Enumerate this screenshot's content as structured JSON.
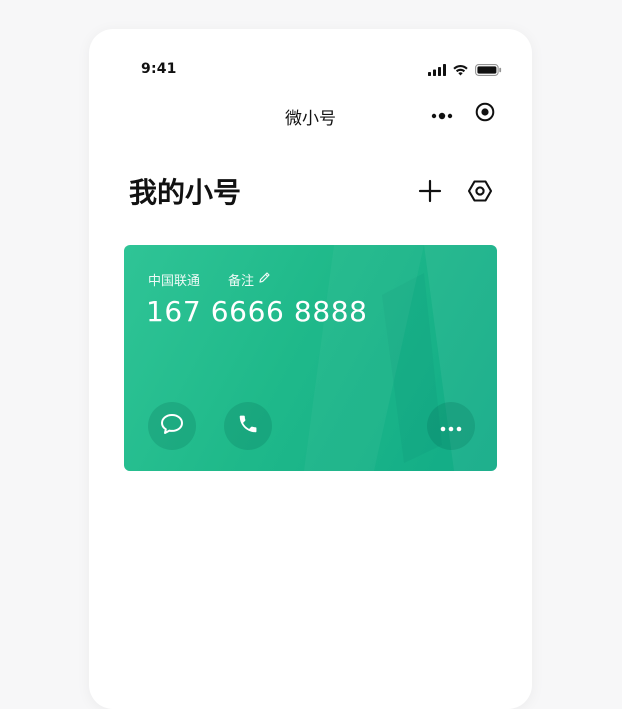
{
  "status_bar": {
    "time": "9:41"
  },
  "nav": {
    "title": "微小号"
  },
  "page": {
    "title": "我的小号"
  },
  "card": {
    "carrier": "中国联通",
    "note_label": "备注",
    "phone_number": "167 6666 8888"
  },
  "icons": {
    "signal": "signal-bars-icon",
    "wifi": "wifi-icon",
    "battery": "battery-icon",
    "capsule_more": "more-dots-icon",
    "capsule_close": "target-circle-icon",
    "add": "plus-icon",
    "settings": "hexagon-settings-icon",
    "edit": "pencil-icon",
    "message": "chat-bubble-icon",
    "call": "phone-handset-icon",
    "more": "ellipsis-icon"
  },
  "colors": {
    "card_gradient_start": "#2fc496",
    "card_gradient_end": "#11ab86",
    "text_primary": "#111111",
    "page_background": "#f7f7f8"
  }
}
